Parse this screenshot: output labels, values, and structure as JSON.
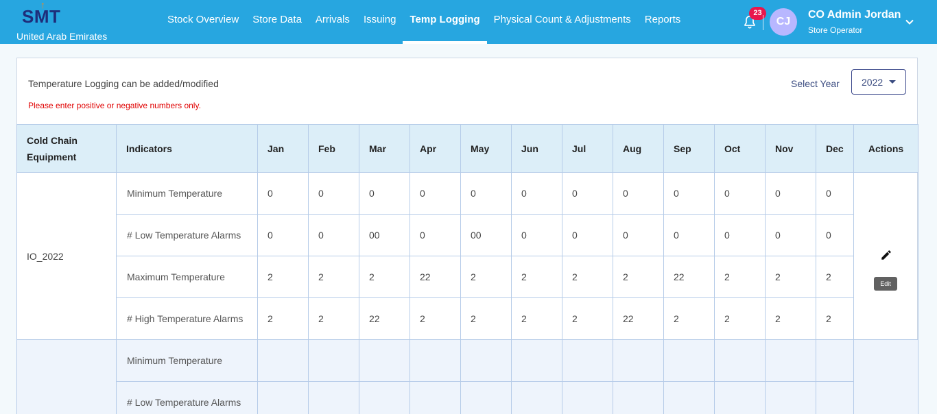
{
  "header": {
    "logo": "SMT",
    "country": "United Arab Emirates",
    "nav": [
      "Stock Overview",
      "Store Data",
      "Arrivals",
      "Issuing",
      "Temp Logging",
      "Physical Count & Adjustments",
      "Reports"
    ],
    "active_nav": "Temp Logging",
    "notification_count": "23",
    "avatar_initials": "CJ",
    "user_name": "CO Admin Jordan",
    "user_role": "Store Operator"
  },
  "card": {
    "info": "Temperature Logging can be added/modified",
    "warning": "Please enter positive or negative numbers only.",
    "year_label": "Select Year",
    "year_value": "2022"
  },
  "table": {
    "columns": [
      "Cold Chain Equipment",
      "Indicators",
      "Jan",
      "Feb",
      "Mar",
      "Apr",
      "May",
      "Jun",
      "Jul",
      "Aug",
      "Sep",
      "Oct",
      "Nov",
      "Dec",
      "Actions"
    ],
    "groups": [
      {
        "equipment": "IO_2022",
        "rows": [
          {
            "indicator": "Minimum Temperature",
            "values": [
              "0",
              "0",
              "0",
              "0",
              "0",
              "0",
              "0",
              "0",
              "0",
              "0",
              "0",
              "0"
            ]
          },
          {
            "indicator": "# Low Temperature Alarms",
            "values": [
              "0",
              "0",
              "00",
              "0",
              "00",
              "0",
              "0",
              "0",
              "0",
              "0",
              "0",
              "0"
            ]
          },
          {
            "indicator": "Maximum Temperature",
            "values": [
              "2",
              "2",
              "2",
              "22",
              "2",
              "2",
              "2",
              "2",
              "22",
              "2",
              "2",
              "2"
            ]
          },
          {
            "indicator": "# High Temperature Alarms",
            "values": [
              "2",
              "2",
              "22",
              "2",
              "2",
              "2",
              "2",
              "22",
              "2",
              "2",
              "2",
              "2"
            ]
          }
        ],
        "action_tooltip": "Edit"
      },
      {
        "equipment": "",
        "rows": [
          {
            "indicator": "Minimum Temperature",
            "values": [
              "",
              "",
              "",
              "",
              "",
              "",
              "",
              "",
              "",
              "",
              "",
              ""
            ]
          },
          {
            "indicator": "# Low Temperature Alarms",
            "values": [
              "",
              "",
              "",
              "",
              "",
              "",
              "",
              "",
              "",
              "",
              "",
              ""
            ]
          }
        ]
      }
    ]
  },
  "colors": {
    "topbar": "#27a6e0",
    "header_row": "#dceef8",
    "badge": "#e8174d",
    "warning": "#e00000"
  },
  "icons": {
    "bell": "bell-icon",
    "chevron": "chevron-down-icon",
    "edit": "pencil-icon",
    "dropdown": "caret-down-icon"
  }
}
